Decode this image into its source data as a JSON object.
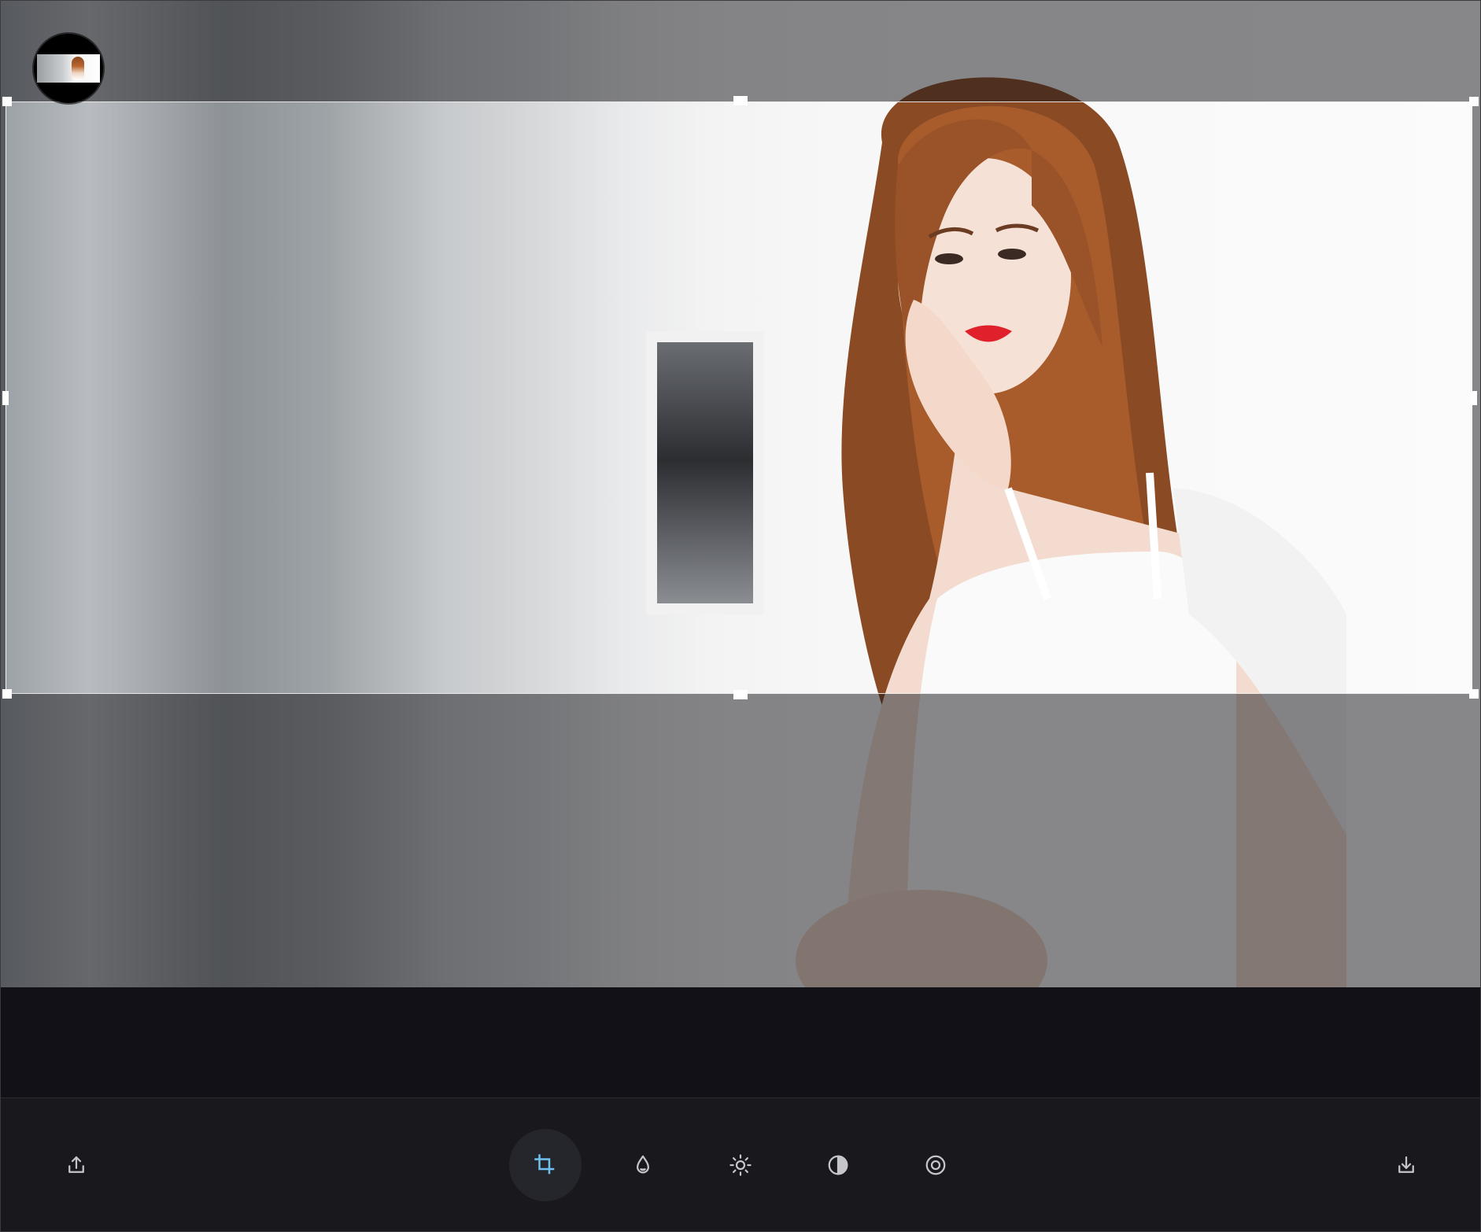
{
  "colors": {
    "toolbar_bg": "#19191d",
    "canvas_bg": "#121117",
    "icon": "#c4c6cc",
    "accent": "#6ec1f0",
    "active_bg": "#25262b"
  },
  "thumbnail": {
    "icon": "image-thumbnail"
  },
  "toolbar": {
    "left": {
      "icon": "share-icon"
    },
    "tools": [
      {
        "id": "crop",
        "icon": "crop-icon",
        "active": true
      },
      {
        "id": "color",
        "icon": "droplet-icon",
        "active": false
      },
      {
        "id": "brightness",
        "icon": "sun-icon",
        "active": false
      },
      {
        "id": "contrast",
        "icon": "contrast-icon",
        "active": false
      },
      {
        "id": "vignette",
        "icon": "vignette-icon",
        "active": false
      }
    ],
    "right": {
      "icon": "download-icon"
    }
  },
  "crop": {
    "aspect_mode": "free"
  }
}
